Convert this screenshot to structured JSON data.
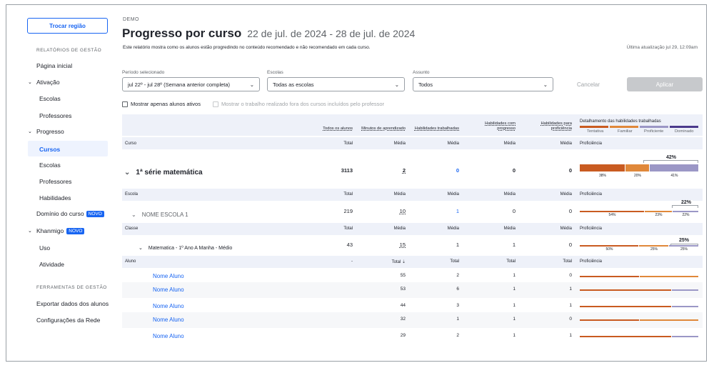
{
  "sidebar": {
    "region_button": "Trocar região",
    "section_reports": "RELATÓRIOS DE GESTÃO",
    "home": "Página inicial",
    "activation": "Ativação",
    "activation_schools": "Escolas",
    "activation_teachers": "Professores",
    "progress": "Progresso",
    "progress_courses": "Cursos",
    "progress_schools": "Escolas",
    "progress_teachers": "Professores",
    "progress_skills": "Habilidades",
    "course_mastery": "Domínio do curso",
    "khanmigo": "Khanmigo",
    "new_badge": "NOVO",
    "khanmigo_usage": "Uso",
    "khanmigo_activity": "Atividade",
    "section_tools": "FERRAMENTAS DE GESTÃO",
    "export": "Exportar dados dos alunos",
    "network_settings": "Configurações da Rede"
  },
  "header": {
    "demo": "DEMO",
    "title": "Progresso por curso",
    "date_range": "22 de jul. de 2024 - 28 de jul. de 2024",
    "subtitle": "Este relatório mostra como os alunos estão progredindo no conteúdo recomendado e não recomendado em cada curso.",
    "last_updated": "Última atualização jul 29, 12:09am"
  },
  "filters": {
    "period_label": "Período selecionado",
    "period_value": "jul 22º - jul 28º (Semana anterior completa)",
    "schools_label": "Escolas",
    "schools_value": "Todas as escolas",
    "subject_label": "Assunto",
    "subject_value": "Todos",
    "cancel": "Cancelar",
    "apply": "Aplicar",
    "active_only": "Mostrar apenas alunos ativos",
    "outside_work": "Mostrar o trabalho realizado fora dos cursos incluídos pelo professor"
  },
  "table": {
    "headers": {
      "all_students": "Todos os alunos",
      "learning_minutes": "Minutos de aprendizado",
      "skills_worked": "Habilidades trabalhadas",
      "skills_progress_1": "Habilidades com",
      "skills_progress_2": "progresso",
      "skills_proficient_1": "Habilidades para",
      "skills_proficient_2": "proficiência",
      "breakdown": "Detalhamento das habilidades trabalhadas"
    },
    "legend": [
      "Tentativa",
      "Familiar",
      "Proficiente",
      "Dominado"
    ],
    "colors": {
      "tentativa": "#c95b21",
      "familiar": "#e0883a",
      "proficiente": "#9b97c6",
      "dominado": "#4b3a8c"
    },
    "course_band": [
      "Curso",
      "Total",
      "Média",
      "Média",
      "Média",
      "Média",
      "Proficiência"
    ],
    "course": {
      "name": "1ª série matemática",
      "total": "3113",
      "minutes": "2",
      "skills": "0",
      "progress": "0",
      "proficient": "0",
      "bars": [
        38,
        20,
        41
      ],
      "bar_labels": [
        "38%",
        "20%",
        "41%"
      ],
      "top": "42%"
    },
    "school_band": [
      "Escola",
      "Total",
      "Média",
      "Média",
      "Média",
      "Média",
      "Proficiência"
    ],
    "school": {
      "name": "NOME ESCOLA 1",
      "total": "219",
      "minutes": "10",
      "skills": "1",
      "progress": "0",
      "proficient": "0",
      "bars": [
        54,
        23,
        22
      ],
      "bar_labels": [
        "54%",
        "23%",
        "22%"
      ],
      "top": "22%"
    },
    "class_band": [
      "Classe",
      "Total",
      "Média",
      "Média",
      "Média",
      "Média",
      "Proficiência"
    ],
    "class": {
      "name": "Matematica - 1º Ano A Manha - Médio",
      "total": "43",
      "minutes": "15",
      "skills": "1",
      "progress": "1",
      "proficient": "0",
      "bars": [
        50,
        25,
        25
      ],
      "bar_labels": [
        "50%",
        "25%",
        "25%"
      ],
      "top": "25%"
    },
    "student_band": [
      "Aluno",
      "-",
      "Total ⇣",
      "Total",
      "Total",
      "Total",
      "Proficiência"
    ],
    "students": [
      {
        "name": "Nome Aluno",
        "minutes": "55",
        "skills": "2",
        "progress": "1",
        "proficient": "0"
      },
      {
        "name": "Nome Aluno",
        "minutes": "53",
        "skills": "6",
        "progress": "1",
        "proficient": "1"
      },
      {
        "name": "Nome Aluno",
        "minutes": "44",
        "skills": "3",
        "progress": "1",
        "proficient": "1"
      },
      {
        "name": "Nome Aluno",
        "minutes": "32",
        "skills": "1",
        "progress": "1",
        "proficient": "0"
      },
      {
        "name": "Nome Aluno",
        "minutes": "29",
        "skills": "2",
        "progress": "1",
        "proficient": "1"
      }
    ]
  }
}
